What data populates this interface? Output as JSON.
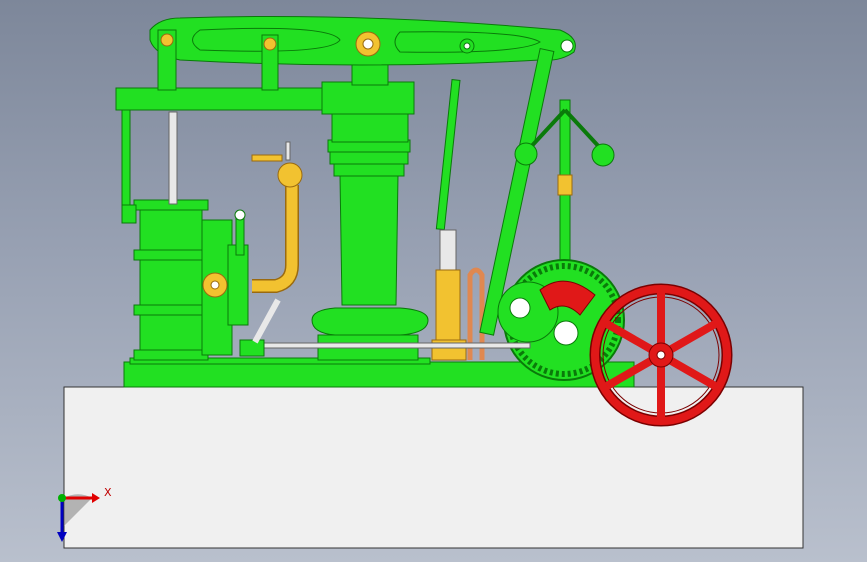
{
  "viewport": {
    "background_top": "#7d879a",
    "background_bottom": "#b9c0cd"
  },
  "model": {
    "colors": {
      "frame": "#22e022",
      "frame_dark": "#0a7a0a",
      "pipe": "#f2c230",
      "pipe_dark": "#9a6a10",
      "flywheel": "#e01818",
      "flywheel_dark": "#7a0000",
      "rod": "#e8e8e8",
      "copper": "#e08850",
      "base": "#f0f0f0"
    },
    "parts": [
      "beam",
      "entablature",
      "column",
      "cylinder",
      "valve-chest",
      "steam-pipe",
      "governor",
      "gear",
      "flywheel",
      "connecting-rod",
      "base-plate"
    ]
  },
  "triad": {
    "x_label": "X",
    "x_color": "#e00000",
    "y_color": "#0000c0",
    "origin_color": "#00b000"
  }
}
